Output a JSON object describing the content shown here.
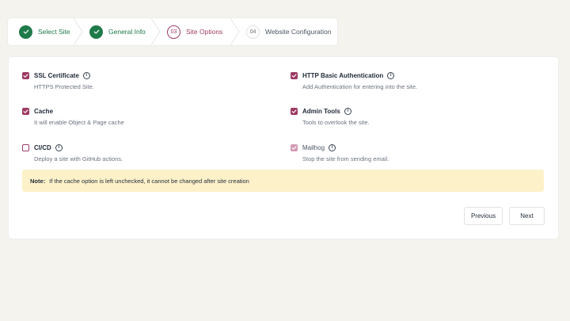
{
  "stepper": {
    "steps": [
      {
        "number": "",
        "label": "Select Site",
        "state": "done"
      },
      {
        "number": "",
        "label": "General Info",
        "state": "done"
      },
      {
        "number": "03",
        "label": "Site Options",
        "state": "active"
      },
      {
        "number": "04",
        "label": "Website Configuration",
        "state": "todo"
      }
    ]
  },
  "options": {
    "ssl": {
      "title": "SSL Certificate",
      "description": "HTTPS Protected Site.",
      "checked": true
    },
    "http": {
      "title": "HTTP Basic Authentication",
      "description": "Add Authentication for entering into the site.",
      "checked": true
    },
    "cache": {
      "title": "Cache",
      "description": "It will enable Object & Page cache",
      "checked": true
    },
    "admin": {
      "title": "Admin Tools",
      "description": "Tools to overlook the site.",
      "checked": true
    },
    "cicd": {
      "title": "CI/CD",
      "description": "Deploy a site with GitHub actions.",
      "checked": false
    },
    "mail": {
      "title": "Mailhog",
      "description": "Stop the site from sending email.",
      "checked": true,
      "disabled": true
    }
  },
  "info_icon_glyph": "i",
  "note": {
    "label": "Note:",
    "text": "If the cache option is left unchecked, it cannot be changed after site creation"
  },
  "buttons": {
    "previous": "Previous",
    "next": "Next"
  },
  "colors": {
    "done": "#1f7a4a",
    "active": "#a23d67",
    "checkbox": "#9c3a63",
    "note_bg": "#fdf1c9",
    "background": "#f4f3ee"
  }
}
